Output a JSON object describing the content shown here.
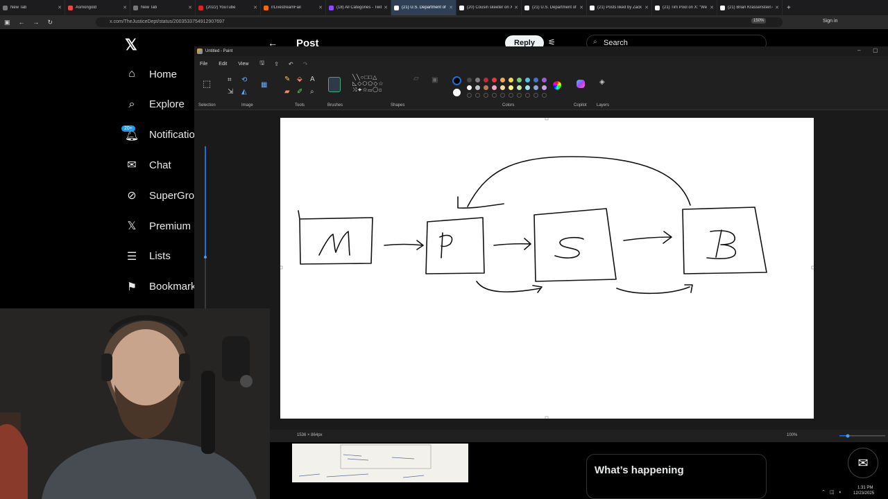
{
  "browser": {
    "tabs": [
      {
        "label": "New Tab",
        "active": false
      },
      {
        "label": "Asmongold",
        "active": false
      },
      {
        "label": "New Tab",
        "active": false
      },
      {
        "label": "(2022) YouTube",
        "active": false
      },
      {
        "label": "r/LivestreamFail",
        "active": false
      },
      {
        "label": "(18) All Categories - Twit",
        "active": false
      },
      {
        "label": "(21) U.S. Department of",
        "active": true
      },
      {
        "label": "(20) Cousin skeeter on X",
        "active": false
      },
      {
        "label": "(21) U.S. Department of",
        "active": false
      },
      {
        "label": "(21) Posts liked by Zack",
        "active": false
      },
      {
        "label": "(21) Tim Pool on X: \"We",
        "active": false
      },
      {
        "label": "(21) Brian Krassenstein o",
        "active": false
      }
    ],
    "url": "x.com/TheJusticeDept/status/2003533754912907697",
    "zoom": "150%",
    "signin": "Sign in"
  },
  "x_sidebar": {
    "items": [
      {
        "label": "Home",
        "icon": "home-icon"
      },
      {
        "label": "Explore",
        "icon": "search-icon"
      },
      {
        "label": "Notificatio",
        "icon": "bell-icon"
      },
      {
        "label": "Chat",
        "icon": "mail-icon"
      },
      {
        "label": "SuperGro",
        "icon": "grok-icon"
      },
      {
        "label": "Premium",
        "icon": "x-icon"
      },
      {
        "label": "Lists",
        "icon": "list-icon"
      },
      {
        "label": "Bookmark",
        "icon": "bookmark-icon"
      }
    ],
    "notif_badge": "20+"
  },
  "x_header": {
    "title": "Post",
    "reply": "Reply",
    "search_placeholder": "Search"
  },
  "x_right": {
    "whats_happening": "What’s happening"
  },
  "paint": {
    "title": "Untitled - Paint",
    "menu": [
      "File",
      "Edit",
      "View"
    ],
    "groups": [
      "Selection",
      "Image",
      "Tools",
      "Brushes",
      "Shapes",
      "Colors",
      "Copilot",
      "Layers"
    ],
    "canvas_size": "1536 × 864px",
    "zoom": "100%",
    "drawing_labels": [
      "M",
      "P",
      "S",
      "B"
    ]
  },
  "palette": [
    "#000000",
    "#474747",
    "#7f7f7f",
    "#b92d35",
    "#e8383d",
    "#f2a65a",
    "#f6d84a",
    "#7bcf6b",
    "#55c2ea",
    "#4472c4",
    "#a259d9",
    "#ffffff",
    "#c3c3c3",
    "#b97a57",
    "#f3a6c5",
    "#f9d89c",
    "#fff27d",
    "#c4e8a0",
    "#a0e1f5",
    "#8ba8d6",
    "#c8a2e8"
  ],
  "clock": {
    "time": "1:31 PM",
    "date": "12/23/2025"
  }
}
